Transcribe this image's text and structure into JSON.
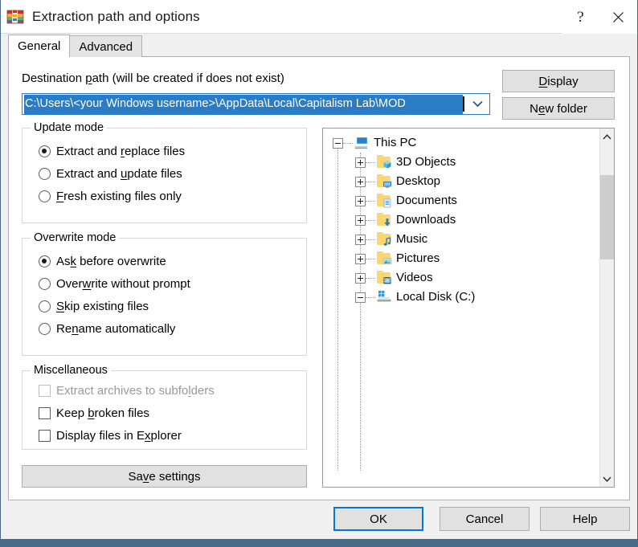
{
  "window": {
    "title": "Extraction path and options",
    "app_icon": "winrar-icon",
    "help_button": "?",
    "close_button": "✕"
  },
  "tabs": [
    {
      "label": "General",
      "active": true
    },
    {
      "label": "Advanced",
      "active": false
    }
  ],
  "destination": {
    "label": "Destination path (will be created if does not exist)",
    "label_accel": "p",
    "value": "C:\\Users\\<your Windows username>\\AppData\\Local\\Capitalism Lab\\MOD",
    "selected": true,
    "dropdown_icon": "chevron-down-icon"
  },
  "side_buttons": {
    "display": "Display",
    "display_accel": "D",
    "new_folder": "New folder",
    "new_folder_accel": "e"
  },
  "update_mode": {
    "title": "Update mode",
    "options": [
      {
        "label": "Extract and replace files",
        "accel": "r",
        "checked": true
      },
      {
        "label": "Extract and update files",
        "accel": "u",
        "checked": false
      },
      {
        "label": "Fresh existing files only",
        "accel": "F",
        "checked": false
      }
    ]
  },
  "overwrite_mode": {
    "title": "Overwrite mode",
    "options": [
      {
        "label": "Ask before overwrite",
        "accel": "k",
        "checked": true
      },
      {
        "label": "Overwrite without prompt",
        "accel": "w",
        "checked": false
      },
      {
        "label": "Skip existing files",
        "accel": "S",
        "checked": false
      },
      {
        "label": "Rename automatically",
        "accel": "n",
        "checked": false
      }
    ]
  },
  "miscellaneous": {
    "title": "Miscellaneous",
    "options": [
      {
        "label": "Extract archives to subfolders",
        "accel": "l",
        "checked": false,
        "disabled": true
      },
      {
        "label": "Keep broken files",
        "accel": "b",
        "checked": false,
        "disabled": false
      },
      {
        "label": "Display files in Explorer",
        "accel": "x",
        "checked": false,
        "disabled": false
      }
    ]
  },
  "save_settings": {
    "label": "Save settings",
    "accel": "v"
  },
  "folder_tree": {
    "nodes": [
      {
        "label": "This PC",
        "icon": "computer-icon",
        "expander": "minus",
        "indent": 0
      },
      {
        "label": "3D Objects",
        "icon": "folder-3d-icon",
        "expander": "plus",
        "indent": 1
      },
      {
        "label": "Desktop",
        "icon": "folder-desktop-icon",
        "expander": "plus",
        "indent": 1
      },
      {
        "label": "Documents",
        "icon": "folder-documents-icon",
        "expander": "plus",
        "indent": 1
      },
      {
        "label": "Downloads",
        "icon": "folder-downloads-icon",
        "expander": "plus",
        "indent": 1
      },
      {
        "label": "Music",
        "icon": "folder-music-icon",
        "expander": "plus",
        "indent": 1
      },
      {
        "label": "Pictures",
        "icon": "folder-pictures-icon",
        "expander": "plus",
        "indent": 1
      },
      {
        "label": "Videos",
        "icon": "folder-videos-icon",
        "expander": "plus",
        "indent": 1
      },
      {
        "label": "Local Disk (C:)",
        "icon": "hard-drive-icon",
        "expander": "minus",
        "indent": 1
      }
    ],
    "scrollbar": {
      "up_icon": "chevron-up-icon",
      "down_icon": "chevron-down-icon"
    }
  },
  "footer": {
    "ok": "OK",
    "cancel": "Cancel",
    "help": "Help"
  },
  "colors": {
    "accent": "#0078d7",
    "selection": "#2b7cc4",
    "dialog_bg": "#f0f0f0",
    "page_bg": "#ffffff",
    "button_bg": "#e1e1e1",
    "title_strip": "#4a6a8a"
  }
}
